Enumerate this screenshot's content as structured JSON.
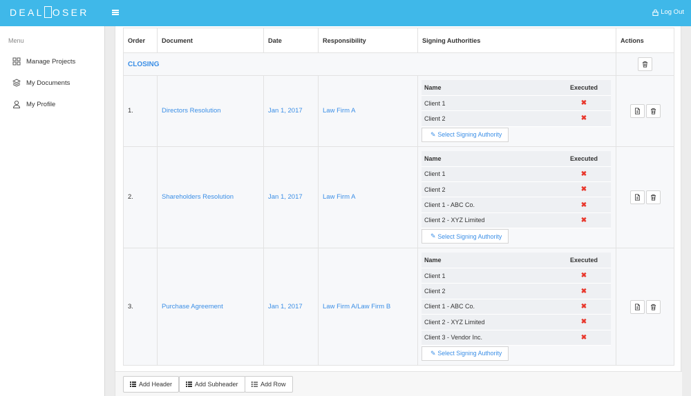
{
  "brand": {
    "letters_left": "DEAL",
    "letters_right": "OSER"
  },
  "header": {
    "logout_label": "Log Out"
  },
  "sidebar": {
    "title": "Menu",
    "items": [
      {
        "label": "Manage Projects",
        "icon": "grid-icon"
      },
      {
        "label": "My Documents",
        "icon": "layers-icon"
      },
      {
        "label": "My Profile",
        "icon": "user-icon"
      }
    ]
  },
  "table": {
    "headers": {
      "order": "Order",
      "document": "Document",
      "date": "Date",
      "responsibility": "Responsibility",
      "signing": "Signing Authorities",
      "actions": "Actions"
    },
    "section": "CLOSING",
    "sig_headers": {
      "name": "Name",
      "executed": "Executed"
    },
    "select_label": "Select Signing Authority",
    "executed_mark": "✖",
    "rows": [
      {
        "order": "1.",
        "document": "Directors Resolution",
        "date": "Jan 1, 2017",
        "responsibility": "Law Firm A",
        "signers": [
          "Client 1",
          "Client 2"
        ]
      },
      {
        "order": "2.",
        "document": "Shareholders Resolution",
        "date": "Jan 1, 2017",
        "responsibility": "Law Firm A",
        "signers": [
          "Client 1",
          "Client 2",
          "Client 1 - ABC Co.",
          "Client 2 - XYZ Limited"
        ]
      },
      {
        "order": "3.",
        "document": "Purchase Agreement",
        "date": "Jan 1, 2017",
        "responsibility": "Law Firm A/Law Firm B",
        "signers": [
          "Client 1",
          "Client 2",
          "Client 1 - ABC Co.",
          "Client 2 - XYZ Limited",
          "Client 3 - Vendor Inc."
        ]
      }
    ]
  },
  "footer": {
    "add_header": "Add Header",
    "add_subheader": "Add Subheader",
    "add_row": "Add Row"
  },
  "colors": {
    "primary": "#3fb8e9",
    "link": "#3a8ee6",
    "danger": "#e8382d"
  }
}
